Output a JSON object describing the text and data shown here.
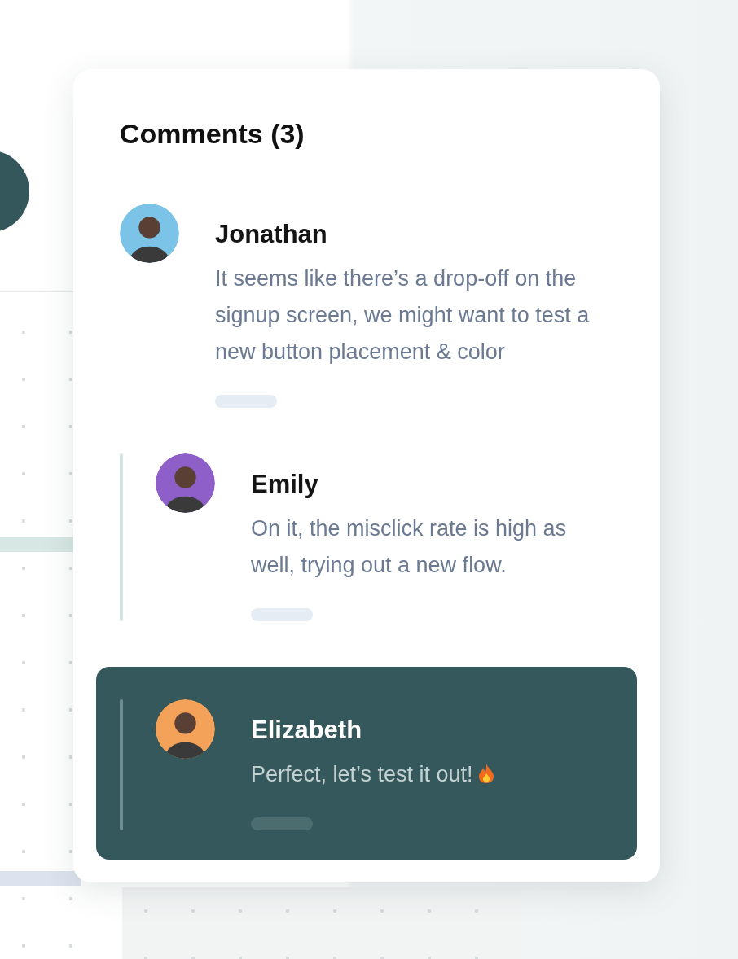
{
  "panel": {
    "title": "Comments (3)"
  },
  "comments": [
    {
      "author": "Jonathan",
      "text": "It seems like there’s a drop-off on the signup screen, we might want to test a new button placement & color",
      "selected": false,
      "children": [
        {
          "author": "Emily",
          "text": "On it, the misclick rate is high as well, trying out a new flow.",
          "selected": false
        },
        {
          "author": "Elizabeth",
          "text": "Perfect, let’s test it out!",
          "selected": true
        }
      ]
    }
  ]
}
